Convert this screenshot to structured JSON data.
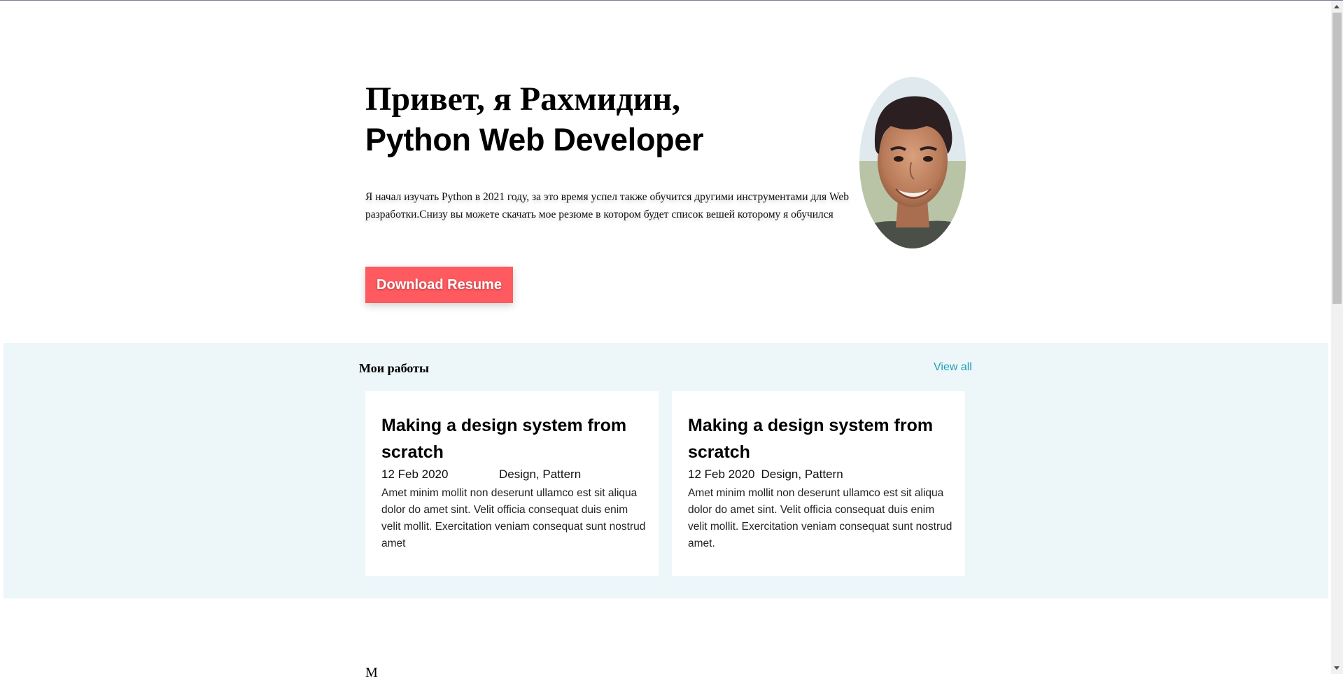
{
  "hero": {
    "greeting": "Привет, я Рахмидин,",
    "role": "Python Web Developer",
    "description": "Я начал изучать Python в 2021 году, за это время успел также обучится другими инструментами для Web разработки.Снизу вы можете скачать мое резюме в котором будет список вешей которому я обучился",
    "resume_button": "Download Resume"
  },
  "works": {
    "title": "Мои работы",
    "view_all": "View all",
    "cards": [
      {
        "title": "Making a design system from scratch",
        "date": "12 Feb 2020",
        "tags": "Design, Pattern",
        "text": "Amet minim mollit non deserunt ullamco est sit aliqua dolor do amet sint. Velit officia consequat duis enim velit mollit. Exercitation veniam consequat sunt nostrud amet"
      },
      {
        "title": "Making a design system from scratch",
        "date": "12 Feb 2020",
        "tags": "Design, Pattern",
        "text": "Amet minim mollit non deserunt ullamco est sit aliqua dolor do amet sint. Velit officia consequat duis enim velit mollit. Exercitation veniam consequat sunt nostrud amet."
      }
    ]
  },
  "next_section": {
    "heading": "М"
  },
  "colors": {
    "accent_button": "#ff5a5f",
    "works_background": "#edf6f9",
    "link": "#1fa0b3"
  },
  "icons": {
    "avatar": "profile-photo",
    "scroll_up": "chevron-up-icon",
    "scroll_down": "chevron-down-icon"
  }
}
